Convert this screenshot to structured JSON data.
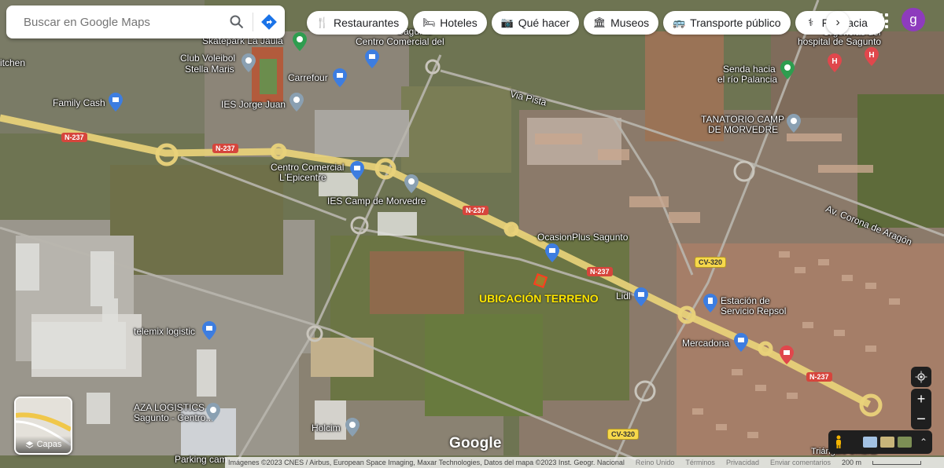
{
  "search": {
    "placeholder": "Buscar en Google Maps"
  },
  "chips": [
    {
      "label": "Restaurantes",
      "icon": "fork-knife-icon"
    },
    {
      "label": "Hoteles",
      "icon": "bed-icon"
    },
    {
      "label": "Qué hacer",
      "icon": "camera-icon"
    },
    {
      "label": "Museos",
      "icon": "museum-icon"
    },
    {
      "label": "Transporte público",
      "icon": "bus-icon"
    },
    {
      "label": "Farmacia",
      "icon": "pharmacy-icon"
    }
  ],
  "avatar_letter": "g",
  "places": {
    "skatepark": "Skatepark La Jaula",
    "centro_sagunto": "Centro Comercial del",
    "sagunto_partial": "Sagunto",
    "kitchen": "itchen",
    "voleibol1": "Club Voleibol",
    "voleibol2": "Stella Maris",
    "carrefour": "Carrefour",
    "family_cash": "Family Cash",
    "ies_jorge": "IES Jorge Juan",
    "via_pista": "Via Pista",
    "tanatorio1": "TANATORIO CAMP",
    "tanatorio2": "DE MORVEDRE",
    "senda1": "Senda hacia",
    "senda2": "el río Palancia",
    "hospital1": "Urgencias del",
    "hospital2": "hospital de Sagunto",
    "centro_epicentre1": "Centro Comercial",
    "centro_epicentre2": "L'Epicentre",
    "ies_camp": "IES Camp de Morvedre",
    "ocasion": "OcasionPlus Sagunto",
    "av_corona": "Av. Corona de Aragón",
    "lidl": "Lidl",
    "repsol1": "Estación de",
    "repsol2": "Servicio Repsol",
    "mercadona": "Mercadona",
    "telemix": "telemix logistic",
    "aza1": "AZA LOGISTICS",
    "aza2": "Sagunto - Centro...",
    "holcim": "Holcim",
    "parking": "Parking cam",
    "triangulo": "Triángulo Umbral",
    "ubicacion": "UBICACIÓN TERRENO"
  },
  "roads": {
    "n237": "N-237",
    "cv320": "CV-320"
  },
  "footer": {
    "attribution": "Imágenes ©2023 CNES / Airbus, European Space Imaging, Maxar Technologies, Datos del mapa ©2023 Inst. Geogr. Nacional",
    "country": "Reino Unido",
    "terms": "Términos",
    "privacy": "Privacidad",
    "feedback": "Enviar comentarios",
    "scale": "200 m"
  },
  "layers_label": "Capas",
  "google_logo": "Google",
  "colors": {
    "route": "#e9d27a",
    "terreno_label": "#ffe600",
    "terreno_outline": "#ff3b1f",
    "poi_blue": "#3d7de0",
    "poi_green": "#2e9d4f",
    "poi_red": "#e0474c",
    "avatar": "#8e3bbd"
  }
}
